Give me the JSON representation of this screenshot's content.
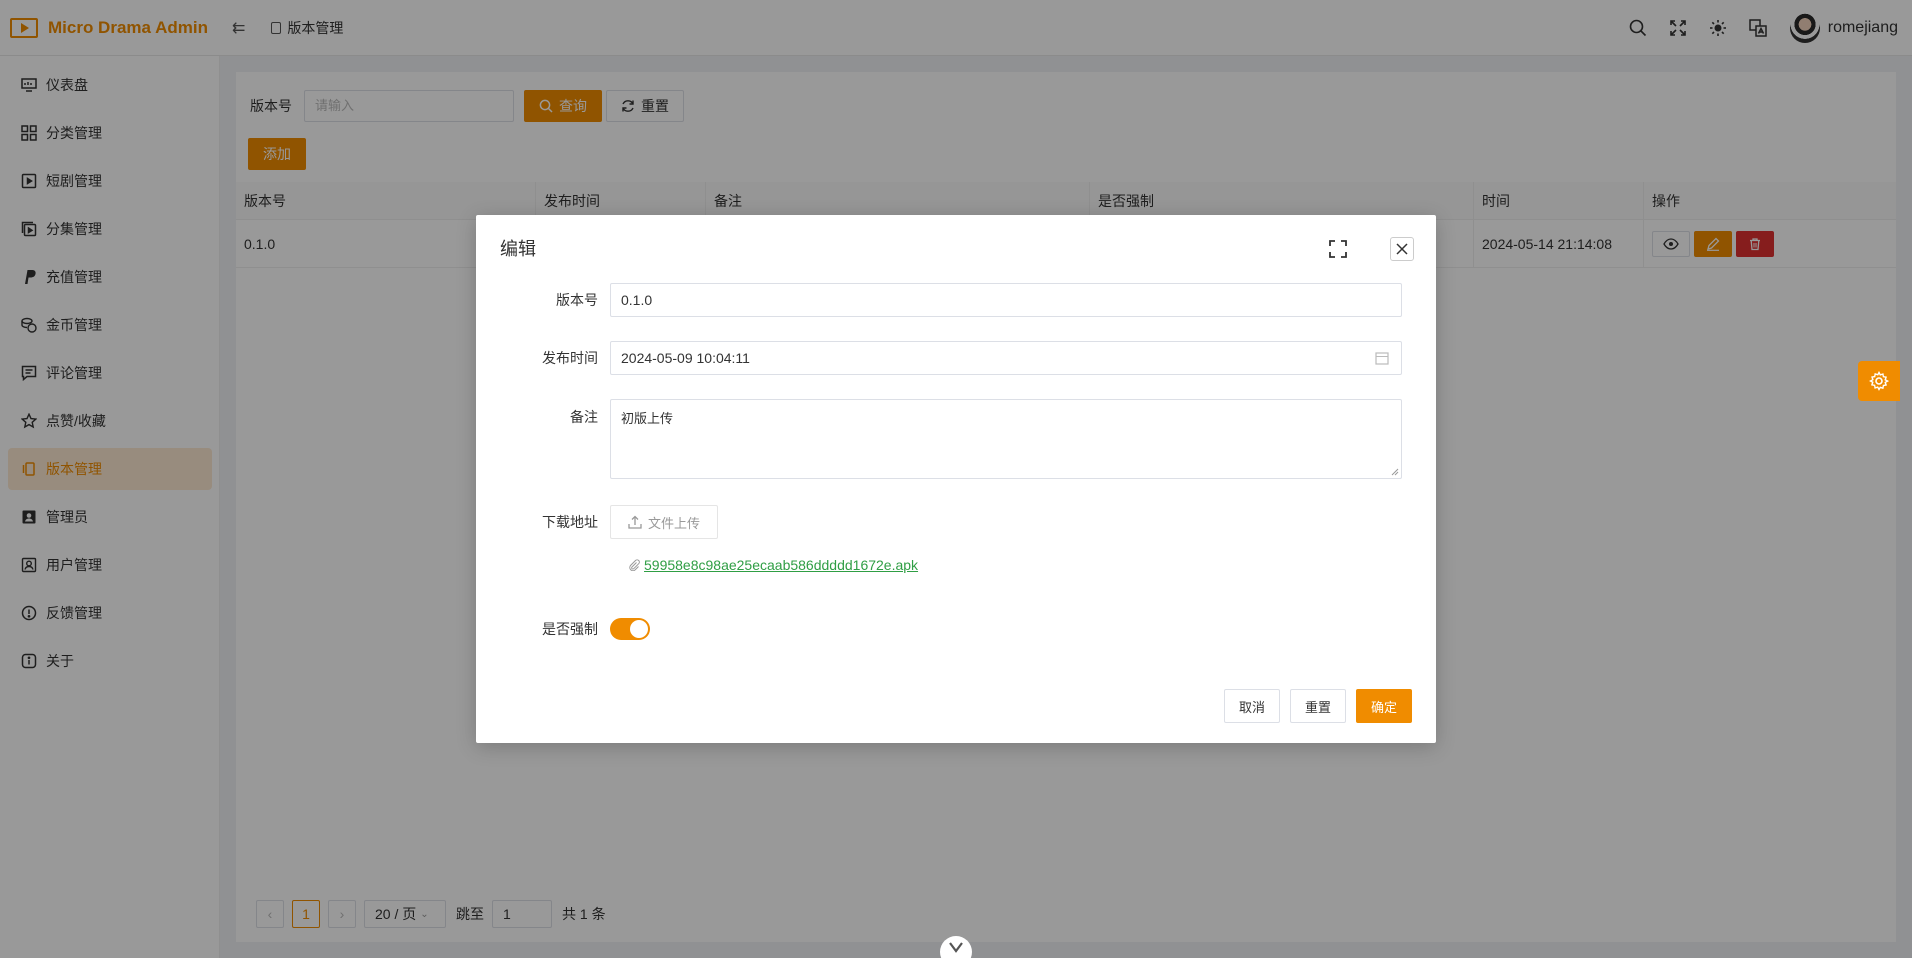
{
  "app": {
    "title": "Micro Drama Admin"
  },
  "header": {
    "breadcrumb": "版本管理",
    "username": "romejiang"
  },
  "sidebar": {
    "items": [
      {
        "label": "仪表盘",
        "icon": "dashboard-icon"
      },
      {
        "label": "分类管理",
        "icon": "grid-icon"
      },
      {
        "label": "短剧管理",
        "icon": "film-icon"
      },
      {
        "label": "分集管理",
        "icon": "video-icon"
      },
      {
        "label": "充值管理",
        "icon": "paypal-icon"
      },
      {
        "label": "金币管理",
        "icon": "coins-icon"
      },
      {
        "label": "评论管理",
        "icon": "comment-icon"
      },
      {
        "label": "点赞/收藏",
        "icon": "star-icon"
      },
      {
        "label": "版本管理",
        "icon": "version-icon",
        "active": true
      },
      {
        "label": "管理员",
        "icon": "admin-icon"
      },
      {
        "label": "用户管理",
        "icon": "user-icon"
      },
      {
        "label": "反馈管理",
        "icon": "feedback-icon"
      },
      {
        "label": "关于",
        "icon": "info-icon"
      }
    ]
  },
  "search": {
    "label": "版本号",
    "placeholder": "请输入",
    "query_label": "查询",
    "reset_label": "重置",
    "add_label": "添加"
  },
  "table": {
    "columns": [
      "版本号",
      "发布时间",
      "备注",
      "是否强制",
      "时间",
      "操作"
    ],
    "rows": [
      {
        "version": "0.1.0",
        "time": "2024-05-14 21:14:08"
      }
    ]
  },
  "pagination": {
    "current": "1",
    "page_size": "20 / 页",
    "jump_label": "跳至",
    "jump_value": "1",
    "total": "共 1 条"
  },
  "modal": {
    "title": "编辑",
    "fields": {
      "version": {
        "label": "版本号",
        "value": "0.1.0"
      },
      "publish_time": {
        "label": "发布时间",
        "value": "2024-05-09 10:04:11"
      },
      "note": {
        "label": "备注",
        "value": "初版上传"
      },
      "download": {
        "label": "下载地址",
        "upload_label": "文件上传",
        "file_name": "59958e8c98ae25ecaab586ddddd1672e.apk"
      },
      "force": {
        "label": "是否强制",
        "value": true
      }
    },
    "buttons": {
      "cancel": "取消",
      "reset": "重置",
      "confirm": "确定"
    }
  },
  "colors": {
    "accent": "#f08c00",
    "danger": "#e03131",
    "link": "#2f9e44"
  }
}
